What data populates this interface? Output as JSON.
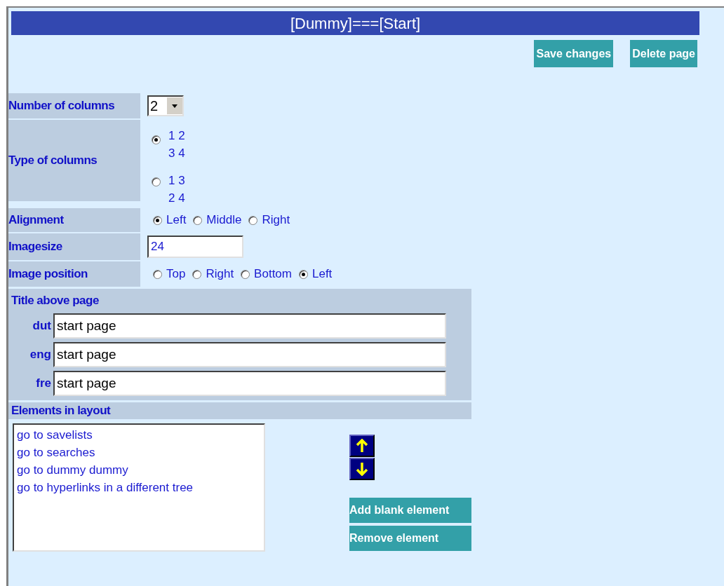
{
  "title": "[Dummy]===[Start]",
  "top_buttons": [
    "Save changes",
    "Delete page"
  ],
  "number_of_columns": {
    "label": "Number of columns",
    "value": "2"
  },
  "type_of_columns": {
    "label": "Type of columns",
    "options": [
      {
        "lines": [
          "1 2",
          "3 4"
        ],
        "selected": true
      },
      {
        "lines": [
          "1 3",
          "2 4"
        ],
        "selected": false
      }
    ]
  },
  "alignment": {
    "label": "Alignment",
    "options": [
      {
        "label": "Left",
        "selected": true
      },
      {
        "label": "Middle",
        "selected": false
      },
      {
        "label": "Right",
        "selected": false
      }
    ]
  },
  "imagesize": {
    "label": "Imagesize",
    "value": "24"
  },
  "image_position": {
    "label": "Image position",
    "options": [
      {
        "label": "Top",
        "selected": false
      },
      {
        "label": "Right",
        "selected": false
      },
      {
        "label": "Bottom",
        "selected": false
      },
      {
        "label": "Left",
        "selected": true
      }
    ]
  },
  "title_above_page": {
    "label": "Title above page",
    "fields": [
      {
        "language": "dut",
        "value": "start page"
      },
      {
        "language": "eng",
        "value": "start page"
      },
      {
        "language": "fre",
        "value": "start page"
      }
    ]
  },
  "elements_in_layout": {
    "label": "Elements in layout",
    "items": [
      "go to savelists",
      "go to searches",
      "go to dummy dummy",
      "go to hyperlinks in a different tree"
    ],
    "buttons": [
      "Add blank element",
      "Remove element"
    ]
  }
}
